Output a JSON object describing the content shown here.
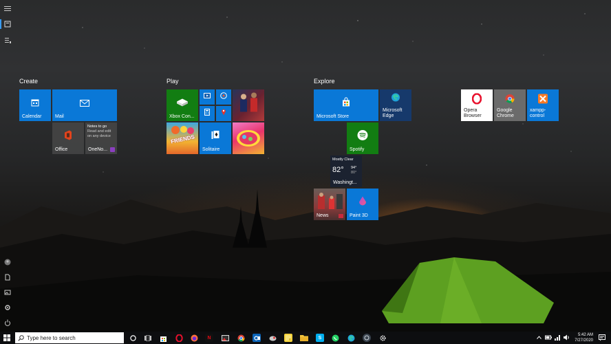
{
  "groups": {
    "create": "Create",
    "play": "Play",
    "explore": "Explore"
  },
  "tiles": {
    "calendar": "Calendar",
    "mail": "Mail",
    "office": "Office",
    "onenote": "OneNo...",
    "onenote_note_title": "Notes to go",
    "onenote_note_body": "Read and edit on any device",
    "xbox": "Xbox Con...",
    "solitaire": "Solitaire",
    "friends": "FRIENDS",
    "microsoft_store": "Microsoft Store",
    "edge": "Microsoft Edge",
    "spotify": "Spotify",
    "weather_condition": "Mostly Clear",
    "weather_temp": "82°",
    "weather_high": "94°",
    "weather_low": "80°",
    "weather_city": "Washingt...",
    "news": "News",
    "paint3d": "Paint 3D",
    "opera": "Opera Browser",
    "chrome": "Google Chrome",
    "xampp": "xampp-control"
  },
  "taskbar": {
    "search_placeholder": "Type here to search",
    "time": "5:42 AM",
    "date": "7/27/2020"
  },
  "colors": {
    "tile_blue": "#0a78d7",
    "xbox_green": "#127d12",
    "spotify_green": "#1db954",
    "accent": "#3a9bf0"
  }
}
